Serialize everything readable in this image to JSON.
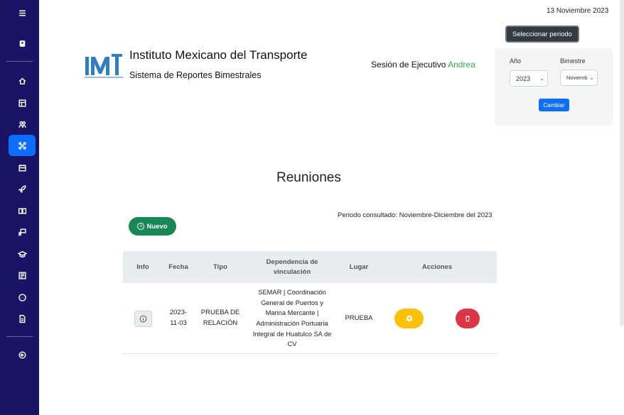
{
  "sidebar": {
    "items": [
      {
        "icon": "menu-icon",
        "active": false
      },
      {
        "icon": "badge-icon",
        "active": false
      },
      {
        "icon": "home-icon",
        "active": false
      },
      {
        "icon": "report-icon",
        "active": false
      },
      {
        "icon": "users-icon",
        "active": false
      },
      {
        "icon": "network-icon",
        "active": true
      },
      {
        "icon": "group-icon",
        "active": false
      },
      {
        "icon": "rocket-icon",
        "active": false
      },
      {
        "icon": "book-icon",
        "active": false
      },
      {
        "icon": "presentation-icon",
        "active": false
      },
      {
        "icon": "graduation-cap-icon",
        "active": false
      },
      {
        "icon": "newspaper-icon",
        "active": false
      },
      {
        "icon": "more-icon",
        "active": false
      },
      {
        "icon": "document-icon",
        "active": false
      },
      {
        "icon": "logout-icon",
        "active": false
      }
    ]
  },
  "header": {
    "date": "13 Noviembre 2023",
    "select_period_label": "Seleccionar periodo",
    "org_name": "Instituto Mexicano del Transporte",
    "org_subtitle": "Sistema de Reportes Bimestrales",
    "logo_text": "IMT",
    "session_prefix": "Sesión de Ejecutivo ",
    "session_user": "Andrea",
    "session_user_color": "#2bb24c"
  },
  "period_selector": {
    "year_label": "Año",
    "year_value": "2023",
    "bimester_label": "Bimestre",
    "bimester_value": "Noviembre-Diciembre",
    "change_label": "Cambiar"
  },
  "main": {
    "title": "Reuniones",
    "period_consulted": "Periodo consultado: Noviembre-Diciembre del 2023",
    "new_label": "Nuevo"
  },
  "table": {
    "headers": [
      "Info",
      "Fecha",
      "Tipo",
      "Dependencia de vinculación",
      "Lugar",
      "Acciones"
    ],
    "rows": [
      {
        "fecha": "2023-11-03",
        "tipo": "PRUEBA DE RELACIÓN",
        "dependencia": "SEMAR | Coordinación General de Puertos y Marina Mercante | Administración Portuaria Integral de Huatulco SA de CV",
        "lugar": "PRUEBA"
      }
    ]
  },
  "colors": {
    "sidebar": "#1a1466",
    "active": "#0d6efd",
    "new_button": "#198754",
    "upload_button": "#ffc107",
    "delete_button": "#dc3545"
  }
}
